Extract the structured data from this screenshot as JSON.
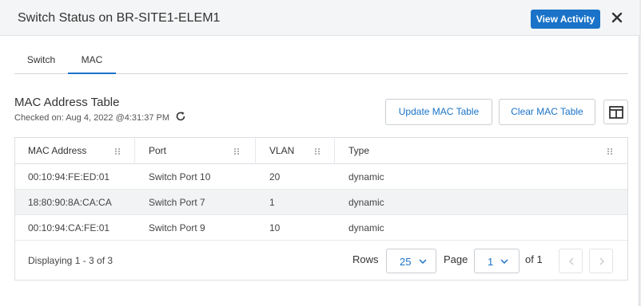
{
  "header": {
    "title": "Switch Status on BR-SITE1-ELEM1",
    "view_activity_label": "View Activity"
  },
  "tabs": [
    {
      "label": "Switch",
      "active": false
    },
    {
      "label": "MAC",
      "active": true
    }
  ],
  "section": {
    "title": "MAC Address Table",
    "checked_on": "Checked on: Aug 4, 2022 @4:31:37 PM",
    "update_button": "Update MAC Table",
    "clear_button": "Clear MAC Table"
  },
  "table": {
    "columns": [
      "MAC Address",
      "Port",
      "VLAN",
      "Type"
    ],
    "rows": [
      [
        "00:10:94:FE:ED:01",
        "Switch Port 10",
        "20",
        "dynamic"
      ],
      [
        "18:80:90:8A:CA:CA",
        "Switch Port 7",
        "1",
        "dynamic"
      ],
      [
        "00:10:94:CA:FE:01",
        "Switch Port 9",
        "10",
        "dynamic"
      ]
    ]
  },
  "footer": {
    "displaying": "Displaying 1 - 3 of 3",
    "rows_label": "Rows",
    "rows_value": "25",
    "page_label": "Page",
    "page_value": "1",
    "of_pages": "of 1"
  },
  "colors": {
    "accent": "#1a73c8"
  },
  "icons": [
    "close-icon",
    "refresh-icon",
    "layout-columns-icon",
    "grip-icon",
    "chevron-down-icon",
    "chevron-left-icon",
    "chevron-right-icon"
  ]
}
